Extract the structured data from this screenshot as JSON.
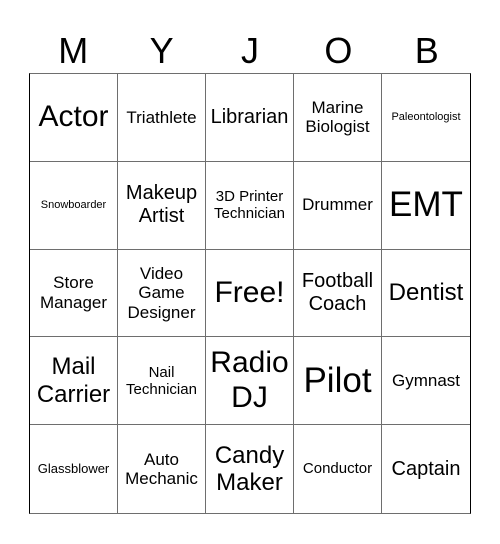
{
  "title_letters": [
    "M",
    "Y",
    "J",
    "O",
    "B"
  ],
  "cells": [
    {
      "label": "Actor"
    },
    {
      "label": "Triathlete"
    },
    {
      "label": "Librarian"
    },
    {
      "label": "Marine Biologist"
    },
    {
      "label": "Paleontologist"
    },
    {
      "label": "Snowboarder"
    },
    {
      "label": "Makeup Artist"
    },
    {
      "label": "3D Printer Technician"
    },
    {
      "label": "Drummer"
    },
    {
      "label": "EMT"
    },
    {
      "label": "Store Manager"
    },
    {
      "label": "Video Game Designer"
    },
    {
      "label": "Free!"
    },
    {
      "label": "Football Coach"
    },
    {
      "label": "Dentist"
    },
    {
      "label": "Mail Carrier"
    },
    {
      "label": "Nail Technician"
    },
    {
      "label": "Radio DJ"
    },
    {
      "label": "Pilot"
    },
    {
      "label": "Gymnast"
    },
    {
      "label": "Glassblower"
    },
    {
      "label": "Auto Mechanic"
    },
    {
      "label": "Candy Maker"
    },
    {
      "label": "Conductor"
    },
    {
      "label": "Captain"
    }
  ]
}
